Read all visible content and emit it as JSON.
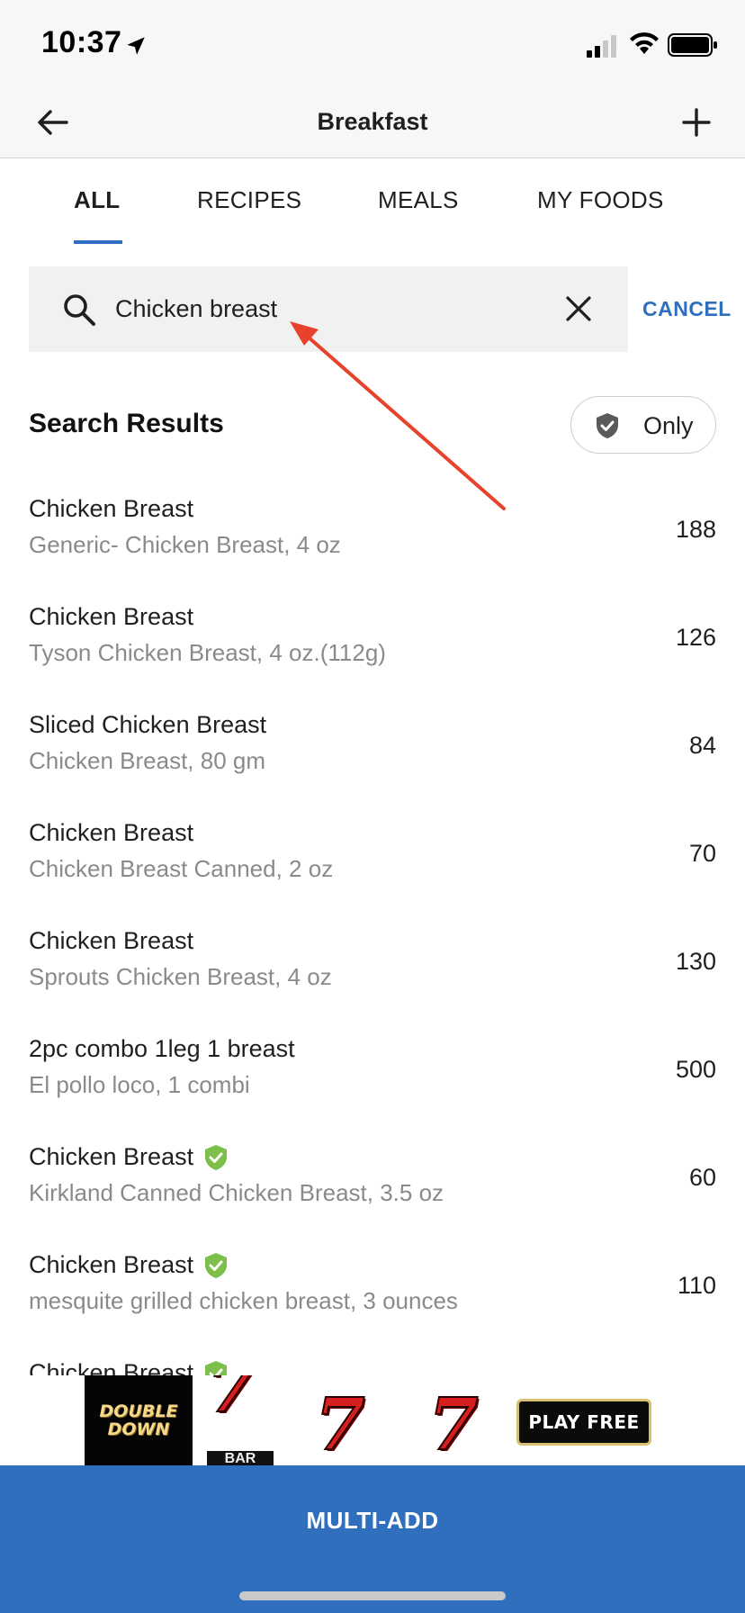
{
  "status_bar": {
    "time": "10:37"
  },
  "header": {
    "title": "Breakfast"
  },
  "tabs": [
    {
      "label": "ALL",
      "active": true
    },
    {
      "label": "RECIPES",
      "active": false
    },
    {
      "label": "MEALS",
      "active": false
    },
    {
      "label": "MY FOODS",
      "active": false
    }
  ],
  "search": {
    "value": "Chicken breast",
    "cancel_label": "CANCEL"
  },
  "results": {
    "title": "Search Results",
    "verified_filter_label": "Only",
    "items": [
      {
        "name": "Chicken Breast",
        "desc": "Generic- Chicken Breast, 4 oz",
        "calories": "188",
        "verified": false
      },
      {
        "name": "Chicken Breast",
        "desc": "Tyson Chicken Breast, 4 oz.(112g)",
        "calories": "126",
        "verified": false
      },
      {
        "name": "Sliced Chicken Breast",
        "desc": "Chicken Breast, 80 gm",
        "calories": "84",
        "verified": false
      },
      {
        "name": "Chicken Breast",
        "desc": "Chicken Breast Canned, 2 oz",
        "calories": "70",
        "verified": false
      },
      {
        "name": "Chicken Breast",
        "desc": "Sprouts Chicken Breast, 4 oz",
        "calories": "130",
        "verified": false
      },
      {
        "name": "2pc combo 1leg 1 breast",
        "desc": "El pollo loco, 1 combi",
        "calories": "500",
        "verified": false
      },
      {
        "name": "Chicken Breast",
        "desc": "Kirkland Canned Chicken Breast, 3.5 oz",
        "calories": "60",
        "verified": true
      },
      {
        "name": "Chicken Breast",
        "desc": "mesquite grilled chicken breast, 3 ounces",
        "calories": "110",
        "verified": true
      },
      {
        "name": "Chicken Breast",
        "desc": "",
        "calories": "",
        "verified": true
      }
    ]
  },
  "ad": {
    "logo_line1": "DOUBLE",
    "logo_line2": "DOWN",
    "bar_text": "BAR",
    "cta_label": "PLAY FREE",
    "seven_glyph": "7"
  },
  "footer": {
    "multi_add_label": "MULTI-ADD"
  },
  "colors": {
    "accent": "#2f6fbd",
    "verified_green": "#7cc04b",
    "annotation_red": "#e8412c"
  }
}
